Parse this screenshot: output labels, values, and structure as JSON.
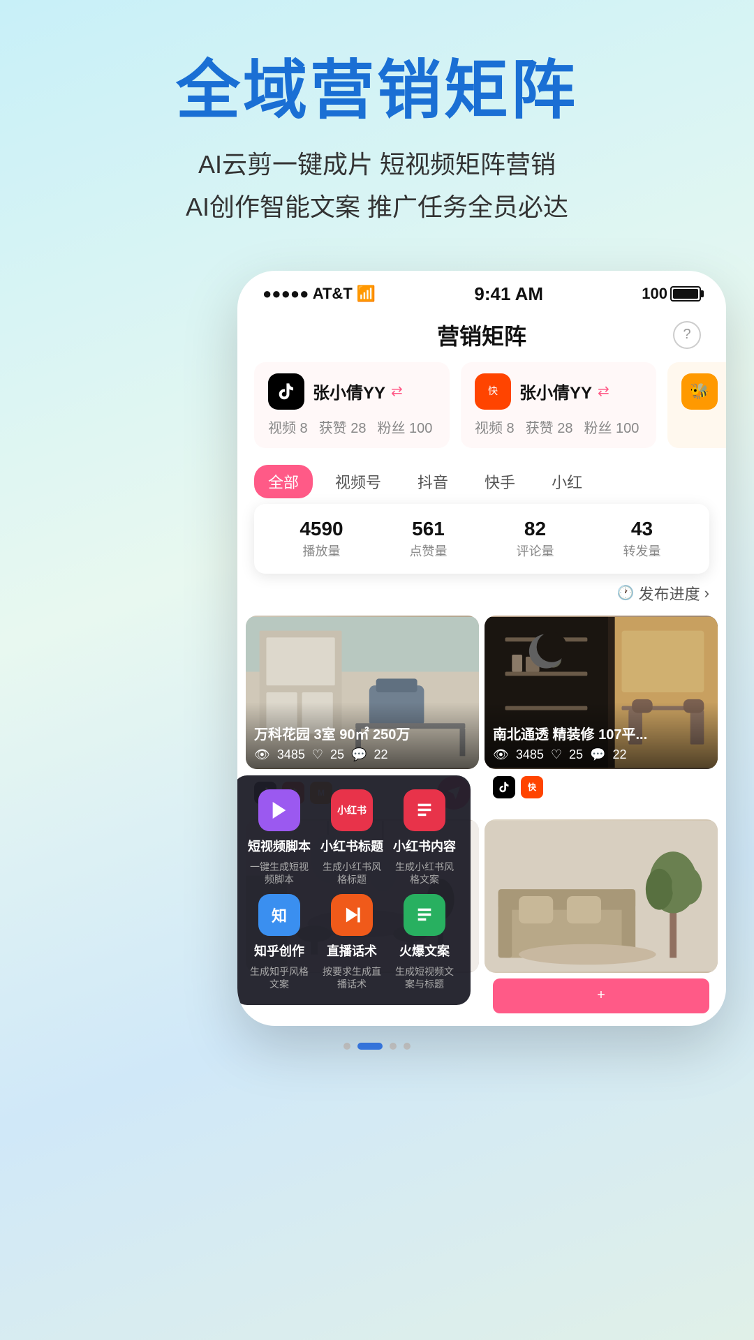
{
  "hero": {
    "title": "全域营销矩阵",
    "subtitle_line1": "AI云剪一键成片 短视频矩阵营销",
    "subtitle_line2": "AI创作智能文案 推广任务全员必达"
  },
  "statusBar": {
    "signal": "●●●●● AT&T",
    "wifi": "▲",
    "time": "9:41 AM",
    "battery": "100"
  },
  "pageTitle": "营销矩阵",
  "helpLabel": "?",
  "accounts": [
    {
      "platform": "tiktok",
      "name": "张小倩YY",
      "videos": "视频 8",
      "likes": "获赞 28",
      "fans": "粉丝 100"
    },
    {
      "platform": "kwai",
      "name": "张小倩YY",
      "videos": "视频 8",
      "likes": "获赞 28",
      "fans": "粉丝 100"
    }
  ],
  "filterTabs": [
    "全部",
    "视频号",
    "抖音",
    "快手",
    "小红"
  ],
  "activeTab": 0,
  "publishProgress": "发布进度",
  "stats": {
    "playCount": "4590",
    "playLabel": "播放量",
    "likeCount": "561",
    "likeLabel": "点赞量",
    "commentCount": "82",
    "commentLabel": "评论量",
    "shareCount": "43",
    "shareLabel": "转发量"
  },
  "videos": [
    {
      "title": "万科花园 3室 90㎡ 250万",
      "views": "3485",
      "likes": "25",
      "comments": "22",
      "thumbStyle": "living"
    },
    {
      "title": "南北通透 精装修 107平...",
      "views": "3485",
      "likes": "25",
      "comments": "22",
      "thumbStyle": "room"
    },
    {
      "title": "",
      "views": "",
      "likes": "",
      "comments": "",
      "thumbStyle": "white"
    },
    {
      "title": "",
      "views": "",
      "likes": "",
      "comments": "",
      "thumbStyle": "beige"
    }
  ],
  "aiMenu": {
    "items": [
      {
        "iconType": "purple",
        "iconEmoji": "▶",
        "title": "短视频脚本",
        "desc": "一键生成短视频脚本"
      },
      {
        "iconType": "red",
        "iconEmoji": "小红书",
        "title": "小红书标题",
        "desc": "生成小红书风格标题"
      },
      {
        "iconType": "red2",
        "iconEmoji": "📄",
        "title": "小红书内容",
        "desc": "生成小红书风格文案"
      },
      {
        "iconType": "blue",
        "iconEmoji": "知",
        "title": "知乎创作",
        "desc": "生成知乎风格文案"
      },
      {
        "iconType": "orange",
        "iconEmoji": "▶",
        "title": "直播话术",
        "desc": "按要求生成直播话术"
      },
      {
        "iconType": "green",
        "iconEmoji": "🔥",
        "title": "火爆文案",
        "desc": "生成短视频文案与标题"
      }
    ]
  },
  "pageDots": [
    "dot1",
    "dot2-active",
    "dot3",
    "dot4"
  ]
}
